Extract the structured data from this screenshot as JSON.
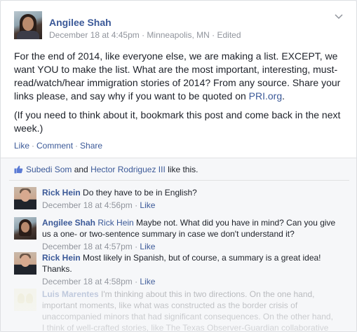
{
  "post": {
    "author": "Angilee Shah",
    "date": "December 18 at 4:45pm",
    "location": "Minneapolis, MN",
    "edited": "Edited",
    "meta_sep": " · ",
    "paragraphs": [
      "For the end of 2014, like everyone else, we are making a list. EXCEPT, we want YOU to make the list. What are the most important, interesting, must-read/watch/hear immigration stories of 2014? From any source. Share your links please, and say why if you want to be quoted on ",
      "(If you need to think about it, bookmark this post and come back in the next week.)"
    ],
    "link_text": "PRI.org",
    "link_suffix": ".",
    "actions": {
      "like": "Like",
      "comment": "Comment",
      "share": "Share",
      "sep": "·"
    }
  },
  "likes": {
    "person1": "Subedi Som",
    "and_text": " and ",
    "person2": "Hector Rodriguez III",
    "suffix": " like this."
  },
  "comments": [
    {
      "name": "Rick Hein",
      "text": " Do they have to be in English?",
      "time": "December 18 at 4:56pm",
      "like": "Like"
    },
    {
      "name": "Angilee Shah",
      "ref": "Rick Hein",
      "text": " Maybe not. What did you have in mind? Can you give us a one- or two-sentence summary in case we don't understand it?",
      "time": "December 18 at 4:57pm",
      "like": "Like"
    },
    {
      "name": "Rick Hein",
      "text": " Most likely in Spanish, but of course, a summary is a great idea! Thanks.",
      "time": "December 18 at 4:58pm",
      "like": "Like"
    },
    {
      "name": "Luis Marentes",
      "text": " I'm thinking about this in two directions. On the one hand, important moments, like what was constructed as the border crisis of unaccompanied minors that had significant consequences. On the other hand, I think of well-crafted stories, like The Texas Observer-Guardian collaborative"
    }
  ],
  "colors": {
    "link": "#3b5998",
    "meta": "#90949c",
    "text": "#1d2129",
    "comments_bg": "#f6f7f9"
  },
  "icons": {
    "menu": "chevron-down-icon",
    "like": "thumbs-up-icon"
  }
}
